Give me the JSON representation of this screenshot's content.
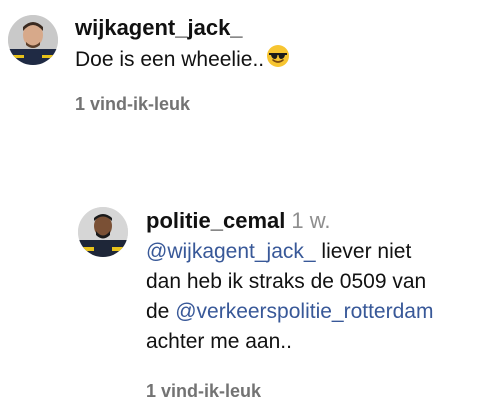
{
  "comments": [
    {
      "username": "wijkagent_jack_",
      "text": "Doe is een wheelie..",
      "emoji": "smiling-face-with-sunglasses",
      "likes": "1 vind-ik-leuk"
    },
    {
      "username": "politie_cemal",
      "time": "1 w.",
      "mention1": "@wijkagent_jack_",
      "text1": " liever niet",
      "text2": "dan heb ik straks de 0509 van",
      "text3_prefix": "de ",
      "mention2": "@verkeerspolitie_rotterdam",
      "text4": "achter me aan..",
      "likes": "1 vind-ik-leuk"
    }
  ],
  "colors": {
    "mention": "#385898",
    "muted": "#737373",
    "time": "#8e8e8e"
  }
}
